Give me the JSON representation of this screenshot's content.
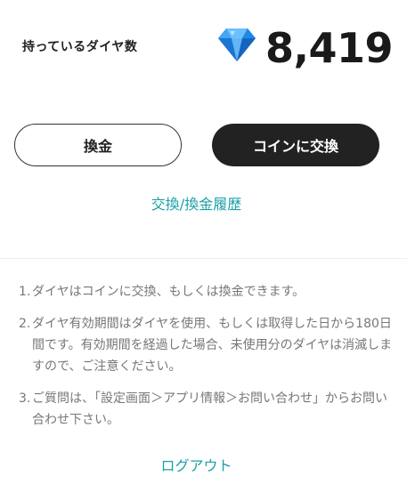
{
  "balance": {
    "label": "持っているダイヤ数",
    "value": "8,419",
    "icon": "diamond-icon"
  },
  "actions": {
    "exchange_label": "換金",
    "convert_label": "コインに交換"
  },
  "links": {
    "history": "交換/換金履歴",
    "logout": "ログアウト"
  },
  "notes": [
    {
      "num": "1.",
      "text": "ダイヤはコインに交換、もしくは換金できます。"
    },
    {
      "num": "2.",
      "text": "ダイヤ有効期間はダイヤを使用、もしくは取得した日から180日間です。有効期間を経過した場合、未使用分のダイヤは消滅しますので、ご注意ください。"
    },
    {
      "num": "3.",
      "text": "ご質問は、「設定画面＞アプリ情報＞お問い合わせ」からお問い合わせ下さい。"
    }
  ],
  "colors": {
    "accent": "#1aa0a8",
    "primary_button": "#222222",
    "diamond": "#2196f3"
  }
}
